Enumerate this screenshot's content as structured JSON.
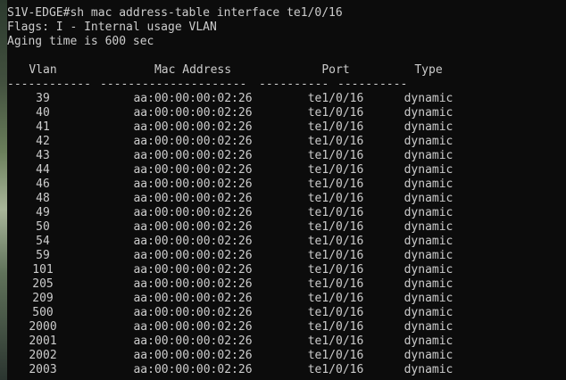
{
  "terminal": {
    "prompt_line": "S1V-EDGE#sh mac address-table interface te1/0/16",
    "flags_line": "Flags: I - Internal usage VLAN",
    "aging_line": "Aging time is 600 sec",
    "columns": {
      "vlan": "Vlan",
      "mac": "Mac Address",
      "port": "Port",
      "type": "Type"
    },
    "separators": {
      "vlan": "------------",
      "mac": "---------------------",
      "port": "----------",
      "type": "----------"
    },
    "rows": [
      {
        "vlan": "39",
        "mac": "aa:00:00:00:02:26",
        "port": "te1/0/16",
        "type": "dynamic"
      },
      {
        "vlan": "40",
        "mac": "aa:00:00:00:02:26",
        "port": "te1/0/16",
        "type": "dynamic"
      },
      {
        "vlan": "41",
        "mac": "aa:00:00:00:02:26",
        "port": "te1/0/16",
        "type": "dynamic"
      },
      {
        "vlan": "42",
        "mac": "aa:00:00:00:02:26",
        "port": "te1/0/16",
        "type": "dynamic"
      },
      {
        "vlan": "43",
        "mac": "aa:00:00:00:02:26",
        "port": "te1/0/16",
        "type": "dynamic"
      },
      {
        "vlan": "44",
        "mac": "aa:00:00:00:02:26",
        "port": "te1/0/16",
        "type": "dynamic"
      },
      {
        "vlan": "46",
        "mac": "aa:00:00:00:02:26",
        "port": "te1/0/16",
        "type": "dynamic"
      },
      {
        "vlan": "48",
        "mac": "aa:00:00:00:02:26",
        "port": "te1/0/16",
        "type": "dynamic"
      },
      {
        "vlan": "49",
        "mac": "aa:00:00:00:02:26",
        "port": "te1/0/16",
        "type": "dynamic"
      },
      {
        "vlan": "50",
        "mac": "aa:00:00:00:02:26",
        "port": "te1/0/16",
        "type": "dynamic"
      },
      {
        "vlan": "54",
        "mac": "aa:00:00:00:02:26",
        "port": "te1/0/16",
        "type": "dynamic"
      },
      {
        "vlan": "59",
        "mac": "aa:00:00:00:02:26",
        "port": "te1/0/16",
        "type": "dynamic"
      },
      {
        "vlan": "101",
        "mac": "aa:00:00:00:02:26",
        "port": "te1/0/16",
        "type": "dynamic"
      },
      {
        "vlan": "205",
        "mac": "aa:00:00:00:02:26",
        "port": "te1/0/16",
        "type": "dynamic"
      },
      {
        "vlan": "209",
        "mac": "aa:00:00:00:02:26",
        "port": "te1/0/16",
        "type": "dynamic"
      },
      {
        "vlan": "500",
        "mac": "aa:00:00:00:02:26",
        "port": "te1/0/16",
        "type": "dynamic"
      },
      {
        "vlan": "2000",
        "mac": "aa:00:00:00:02:26",
        "port": "te1/0/16",
        "type": "dynamic"
      },
      {
        "vlan": "2001",
        "mac": "aa:00:00:00:02:26",
        "port": "te1/0/16",
        "type": "dynamic"
      },
      {
        "vlan": "2002",
        "mac": "aa:00:00:00:02:26",
        "port": "te1/0/16",
        "type": "dynamic"
      },
      {
        "vlan": "2003",
        "mac": "aa:00:00:00:02:26",
        "port": "te1/0/16",
        "type": "dynamic"
      }
    ]
  },
  "colors": {
    "background": "#0c0c0c",
    "text": "#cccccc"
  }
}
